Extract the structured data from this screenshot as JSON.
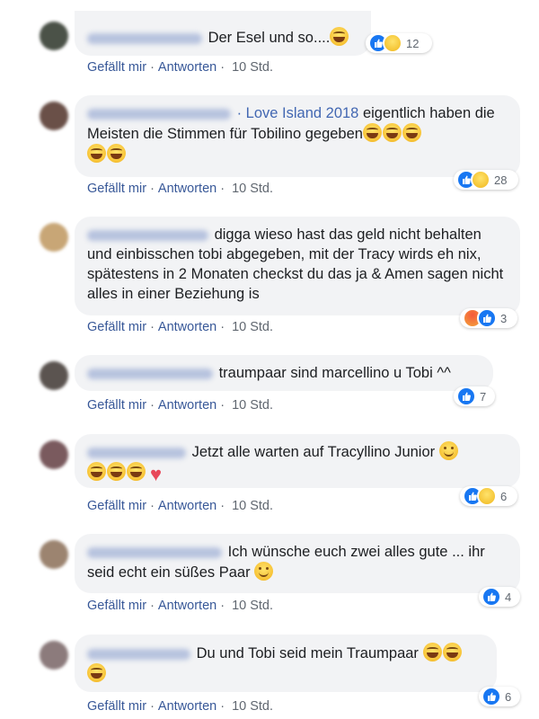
{
  "actions": {
    "like": "Gefällt mir",
    "reply": "Antworten",
    "time": "10 Std.",
    "separator": "·"
  },
  "comments": [
    {
      "text": "Der Esel und so....",
      "reactions": {
        "count": "12"
      }
    },
    {
      "link": "· Love Island 2018",
      "text": " eigentlich haben die Meisten die Stimmen für Tobilino gegeben",
      "reactions": {
        "count": "28"
      }
    },
    {
      "text": "digga wieso hast das geld nicht behalten und einbisschen tobi abgegeben, mit der Tracy wirds eh nix, spätestens in 2 Monaten checkst du das ja & Amen sagen nicht alles in einer Beziehung is",
      "reactions": {
        "count": "3"
      }
    },
    {
      "text": "traumpaar sind marcellino u Tobi ^^",
      "reactions": {
        "count": "7"
      }
    },
    {
      "text": "Jetzt alle warten auf Tracyllino Junior ",
      "reactions": {
        "count": "6"
      }
    },
    {
      "text": "Ich wünsche euch zwei alles gute ... ihr seid echt ein süßes Paar ",
      "reactions": {
        "count": "4"
      }
    },
    {
      "text": " Du und Tobi seid mein Traumpaar ",
      "reactions": {
        "count": "6"
      }
    }
  ],
  "colors": {
    "bubble": "#f2f3f5",
    "link": "#385898",
    "like_blue": "#1877f2"
  }
}
